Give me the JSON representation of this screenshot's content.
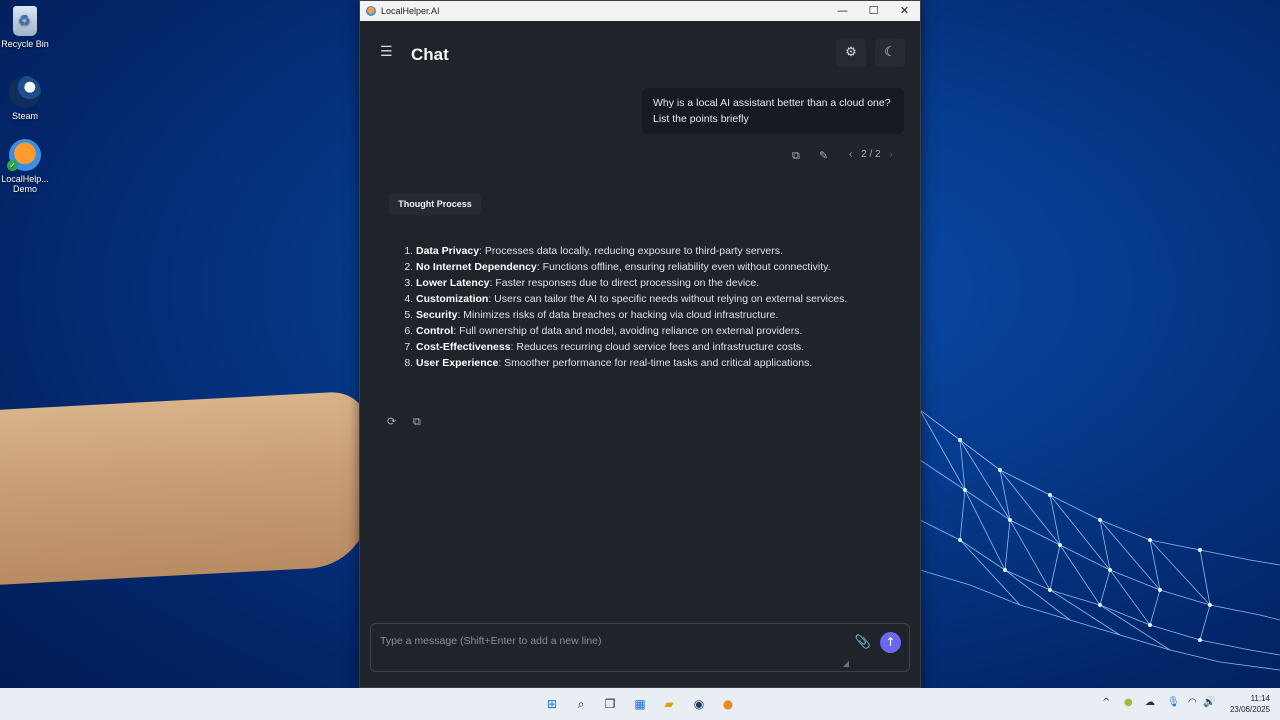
{
  "desktop": {
    "icons": [
      {
        "label": "Recycle Bin"
      },
      {
        "label": "Steam"
      },
      {
        "label": "LocalHelp... Demo"
      }
    ]
  },
  "window": {
    "title": "LocalHelper.AI",
    "controls": {
      "minimize": "—",
      "maximize": "☐",
      "close": "✕"
    }
  },
  "header": {
    "title": "Chat",
    "menu_icon": "☰",
    "settings_icon": "⚙",
    "theme_icon": "☾"
  },
  "conversation": {
    "user_message": "Why is a local AI assistant better than a cloud one? List the points briefly",
    "pager": {
      "prev": "‹",
      "label": "2 / 2",
      "next": "›"
    },
    "thought_button": "Thought Process",
    "answer": [
      {
        "term": "Data Privacy",
        "text": ": Processes data locally, reducing exposure to third-party servers."
      },
      {
        "term": "No Internet Dependency",
        "text": ": Functions offline, ensuring reliability even without connectivity."
      },
      {
        "term": "Lower Latency",
        "text": ": Faster responses due to direct processing on the device."
      },
      {
        "term": "Customization",
        "text": ": Users can tailor the AI to specific needs without relying on external services."
      },
      {
        "term": "Security",
        "text": ": Minimizes risks of data breaches or hacking via cloud infrastructure."
      },
      {
        "term": "Control",
        "text": ": Full ownership of data and model, avoiding reliance on external providers."
      },
      {
        "term": "Cost-Effectiveness",
        "text": ": Reduces recurring cloud service fees and infrastructure costs."
      },
      {
        "term": "User Experience",
        "text": ": Smoother performance for real-time tasks and critical applications."
      }
    ]
  },
  "composer": {
    "placeholder": "Type a message (Shift+Enter to add a new line)",
    "value": "",
    "send_icon": "↑",
    "attach_icon": "📎"
  },
  "taskbar": {
    "time": "11:14",
    "date": "23/06/2025"
  },
  "colors": {
    "accent": "#6a68f0",
    "window_bg": "#1f232a",
    "bubble_bg": "#171b21"
  }
}
